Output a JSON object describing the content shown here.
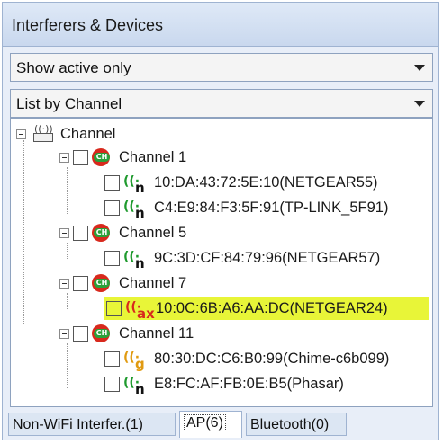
{
  "panel": {
    "title": "Interferers & Devices"
  },
  "filter_combo": {
    "value": "Show active only"
  },
  "list_combo": {
    "value": "List by Channel"
  },
  "tree": {
    "root_label": "Channel",
    "channel_badge": "CH",
    "channels": [
      {
        "label": "Channel 1",
        "devices": [
          {
            "standard": "n",
            "label": "10:DA:43:72:5E:10(NETGEAR55)",
            "color": "#1f9a2e"
          },
          {
            "standard": "n",
            "label": "C4:E9:84:F3:5F:91(TP-LINK_5F91)",
            "color": "#1f9a2e"
          }
        ]
      },
      {
        "label": "Channel 5",
        "devices": [
          {
            "standard": "n",
            "label": "9C:3D:CF:84:79:96(NETGEAR57)",
            "color": "#1f9a2e"
          }
        ]
      },
      {
        "label": "Channel 7",
        "devices": [
          {
            "standard": "ax",
            "label": "10:0C:6B:A6:AA:DC(NETGEAR24)",
            "color": "#d8291d",
            "highlighted": true
          }
        ]
      },
      {
        "label": "Channel 11",
        "devices": [
          {
            "standard": "g",
            "label": "80:30:DC:C6:B0:99(Chime-c6b099)",
            "color": "#e09a10"
          },
          {
            "standard": "n",
            "label": "E8:FC:AF:FB:0E:B5(Phasar)",
            "color": "#1f9a2e"
          }
        ]
      }
    ]
  },
  "tabs": [
    {
      "label": "Non-WiFi Interfer.(1)"
    },
    {
      "label": "AP(6)",
      "active": true
    },
    {
      "label": "Bluetooth(0)"
    }
  ],
  "colors": {
    "highlight": "#e8f538",
    "channel_red": "#d8291d",
    "channel_green": "#2aa13a"
  }
}
